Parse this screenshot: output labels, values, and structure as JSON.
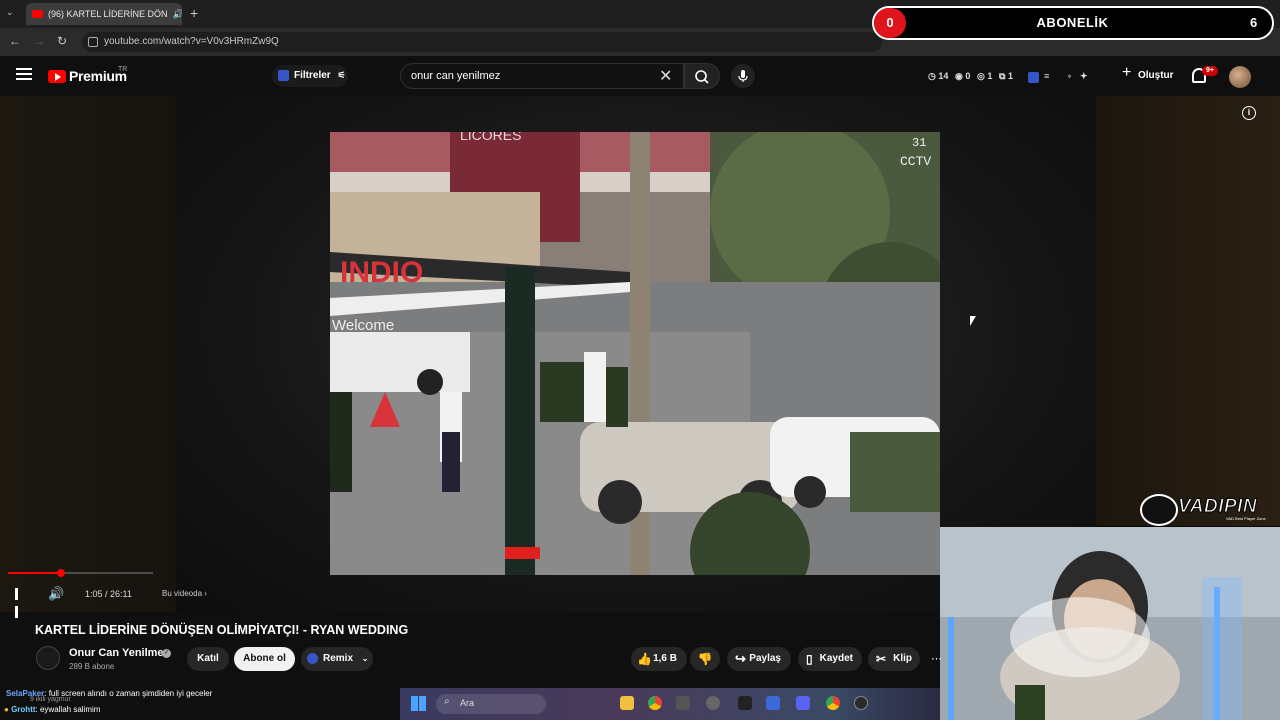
{
  "browser": {
    "tab_title": "(96) KARTEL LİDERİNE DÖN",
    "url": "youtube.com/watch?v=V0v3HRmZw9Q"
  },
  "overlay": {
    "left_count": "0",
    "title": "ABONELİK",
    "right_count": "6",
    "colors": {
      "accent": "#e0141b"
    }
  },
  "header": {
    "logo_text": "Premium",
    "logo_region": "TR",
    "filter_label": "Filtreler",
    "search_value": "onur can yenilmez",
    "stats": [
      "14",
      "0",
      "1",
      "1"
    ],
    "create_label": "Oluştur",
    "notifications": "9+"
  },
  "player": {
    "time": "1:05 / 26:11",
    "chapter": "Bu videoda",
    "progress_fraction": 0.041,
    "frame_text": {
      "sign_top": "LICORES",
      "cctv": "CCTV",
      "sign_num": "31",
      "banner": "INDIO",
      "welcome": "Welcome"
    }
  },
  "video": {
    "title": "KARTEL LİDERİNE DÖNÜŞEN OLİMPİYATÇI! - RYAN WEDDING",
    "channel": "Onur Can Yenilmez",
    "subscribers": "289 B abone",
    "join": "Katıl",
    "subscribe": "Abone ol",
    "remix": "Remix",
    "likes": "1,6 B",
    "share": "Paylaş",
    "save": "Kaydet",
    "clip": "Klip"
  },
  "watermark": {
    "brand": "VADIPIN",
    "sub": "VAD Best Player Zone"
  },
  "chat": {
    "line1_user": "SelaPaker",
    "line1_text": ": full screen alındı o zaman şimdiden iyi geceler",
    "line1_behind": "9 ikili yagmur",
    "line2_user": "Grohtt",
    "line2_text": ": eywallah salimim"
  },
  "taskbar": {
    "search_label": "Ara"
  }
}
